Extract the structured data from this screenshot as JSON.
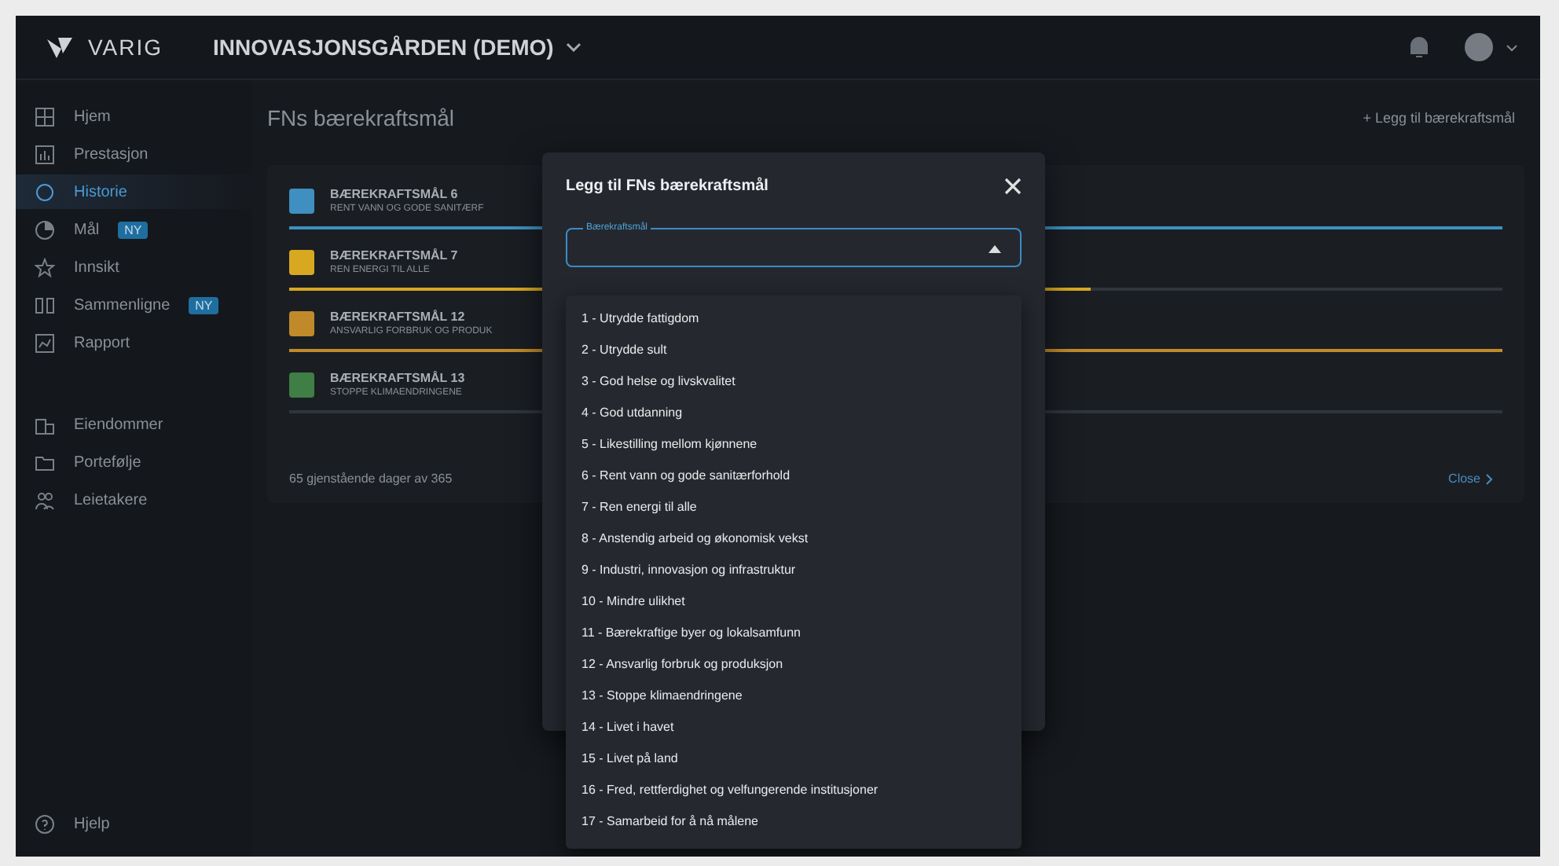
{
  "topbar": {
    "brand": "VARIG",
    "workspace": "INNOVASJONSGÅRDEN (DEMO)"
  },
  "sidebar": {
    "items": [
      {
        "label": "Hjem",
        "selected": false
      },
      {
        "label": "Prestasjon",
        "selected": false
      },
      {
        "label": "Historie",
        "selected": true
      },
      {
        "label": "Mål",
        "selected": false,
        "badge": "NY"
      },
      {
        "label": "Innsikt",
        "selected": false
      },
      {
        "label": "Sammenligne",
        "selected": false,
        "badge": "NY"
      },
      {
        "label": "Rapport",
        "selected": false
      }
    ],
    "items_2": [
      {
        "label": "Eiendommer",
        "selected": false
      },
      {
        "label": "Portefølje",
        "selected": false
      },
      {
        "label": "Leietakere",
        "selected": false
      }
    ],
    "help": "Hjelp"
  },
  "page": {
    "title": "FNs bærekraftsmål",
    "add_button": "+ Legg til bærekraftsmål"
  },
  "goals": [
    {
      "title": "BÆREKRAFTSMÅL 6",
      "subtitle": "RENT VANN OG GODE SANITÆRF",
      "color": "#3f8fc0",
      "level": 1.0
    },
    {
      "title": "BÆREKRAFTSMÅL 7",
      "subtitle": "REN ENERGI TIL ALLE",
      "color": "#d8a820",
      "level": 0.66
    },
    {
      "title": "BÆREKRAFTSMÅL 12",
      "subtitle": "ANSVARLIG FORBRUK OG PRODUK",
      "color": "#c08a2a",
      "level": 1.0
    },
    {
      "title": "BÆREKRAFTSMÅL 13",
      "subtitle": "STOPPE KLIMAENDRINGENE",
      "color": "#3f7e44",
      "level": 0.0
    }
  ],
  "footer": {
    "text": "65 gjenstående dager av 365",
    "close": "Close"
  },
  "dialog": {
    "title": "Legg til FNs bærekraftsmål",
    "field_label": "Bærekraftsmål",
    "expanded": true,
    "options": [
      "1 - Utrydde fattigdom",
      "2 - Utrydde sult",
      "3 - God helse og livskvalitet",
      "4 - God utdanning",
      "5 - Likestilling mellom kjønnene",
      "6 - Rent vann og gode sanitærforhold",
      "7 - Ren energi til alle",
      "8 - Anstendig arbeid og økonomisk vekst",
      "9 - Industri, innovasjon og infrastruktur",
      "10 - Mindre ulikhet",
      "11 - Bærekraftige byer og lokalsamfunn",
      "12 - Ansvarlig forbruk og produksjon",
      "13 - Stoppe klimaendringene",
      "14 - Livet i havet",
      "15 - Livet på land",
      "16 - Fred, rettferdighet og velfungerende institusjoner",
      "17 - Samarbeid for å nå målene"
    ]
  }
}
